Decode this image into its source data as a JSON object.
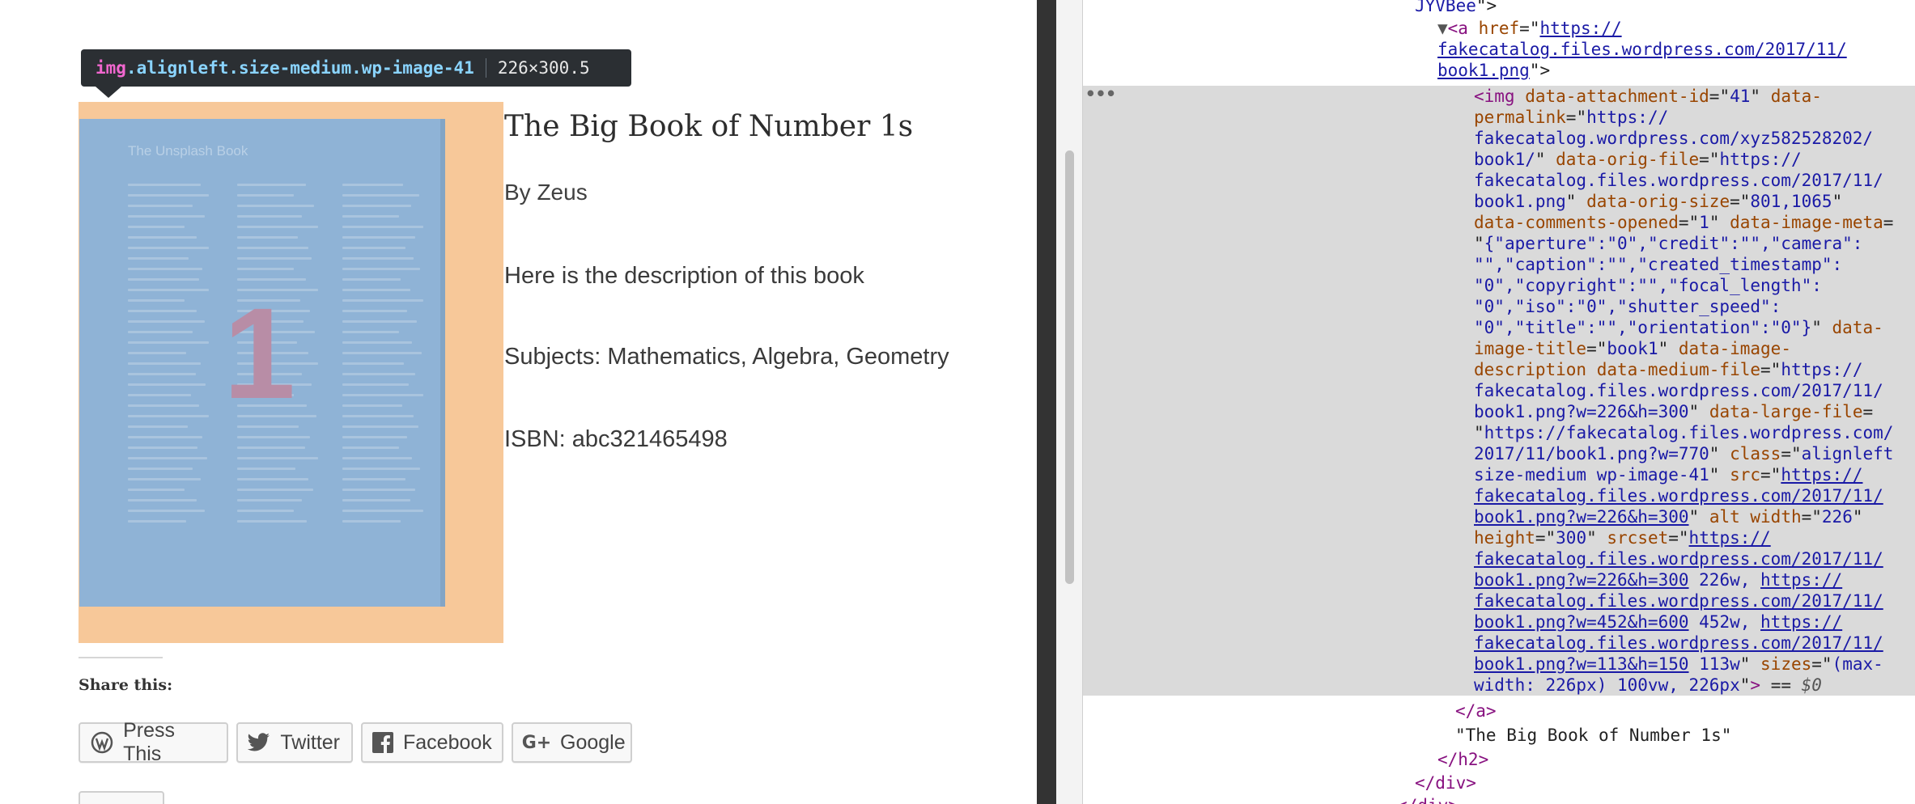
{
  "tooltip": {
    "tag": "img",
    "classes": ".alignleft.size-medium.wp-image-41",
    "dims": "226×300.5"
  },
  "book": {
    "cover_title": "The Unsplash Book",
    "cover_number": "1",
    "title": "The Big Book of Number 1s",
    "author": "By Zeus",
    "description": "Here is the description of this book",
    "subjects": "Subjects: Mathematics, Algebra, Geometry",
    "isbn": "ISBN: abc321465498"
  },
  "share": {
    "label": "Share this:",
    "buttons": [
      {
        "label": "Press This",
        "icon": "wordpress-icon"
      },
      {
        "label": "Twitter",
        "icon": "twitter-icon"
      },
      {
        "label": "Facebook",
        "icon": "facebook-icon"
      },
      {
        "label": "Google",
        "icon": "google-plus-icon"
      }
    ]
  },
  "devtools": {
    "gutter_dots": "•••",
    "lines": [
      [
        {
          "c": "v",
          "t": "JYVBee"
        },
        {
          "c": "p",
          "t": "\">"
        }
      ],
      [
        {
          "c": "tri",
          "t": "▼"
        },
        {
          "c": "t",
          "t": "<a "
        },
        {
          "c": "a",
          "t": "href"
        },
        {
          "c": "p",
          "t": "=\""
        },
        {
          "c": "u",
          "t": "https://"
        }
      ],
      [
        {
          "c": "u",
          "t": "fakecatalog.files.wordpress.com/2017/11/"
        }
      ],
      [
        {
          "c": "u",
          "t": "book1.png"
        },
        {
          "c": "p",
          "t": "\">"
        }
      ],
      [
        {
          "c": "t",
          "t": "<img "
        },
        {
          "c": "a",
          "t": "data-attachment-id"
        },
        {
          "c": "p",
          "t": "=\""
        },
        {
          "c": "v",
          "t": "41"
        },
        {
          "c": "p",
          "t": "\" "
        },
        {
          "c": "a",
          "t": "data-"
        }
      ],
      [
        {
          "c": "a",
          "t": "permalink"
        },
        {
          "c": "p",
          "t": "=\""
        },
        {
          "c": "v",
          "t": "https://"
        }
      ],
      [
        {
          "c": "v",
          "t": "fakecatalog.wordpress.com/xyz582528202/"
        }
      ],
      [
        {
          "c": "v",
          "t": "book1/"
        },
        {
          "c": "p",
          "t": "\" "
        },
        {
          "c": "a",
          "t": "data-orig-file"
        },
        {
          "c": "p",
          "t": "=\""
        },
        {
          "c": "v",
          "t": "https://"
        }
      ],
      [
        {
          "c": "v",
          "t": "fakecatalog.files.wordpress.com/2017/11/"
        }
      ],
      [
        {
          "c": "v",
          "t": "book1.png"
        },
        {
          "c": "p",
          "t": "\" "
        },
        {
          "c": "a",
          "t": "data-orig-size"
        },
        {
          "c": "p",
          "t": "=\""
        },
        {
          "c": "v",
          "t": "801,1065"
        },
        {
          "c": "p",
          "t": "\""
        }
      ],
      [
        {
          "c": "a",
          "t": "data-comments-opened"
        },
        {
          "c": "p",
          "t": "=\""
        },
        {
          "c": "v",
          "t": "1"
        },
        {
          "c": "p",
          "t": "\" "
        },
        {
          "c": "a",
          "t": "data-image-meta"
        },
        {
          "c": "p",
          "t": "="
        }
      ],
      [
        {
          "c": "p",
          "t": "\""
        },
        {
          "c": "v",
          "t": "{\"aperture\":\"0\",\"credit\":\"\",\"camera\":"
        }
      ],
      [
        {
          "c": "v",
          "t": "\"\",\"caption\":\"\",\"created_timestamp\":"
        }
      ],
      [
        {
          "c": "v",
          "t": "\"0\",\"copyright\":\"\",\"focal_length\":"
        }
      ],
      [
        {
          "c": "v",
          "t": "\"0\",\"iso\":\"0\",\"shutter_speed\":"
        }
      ],
      [
        {
          "c": "v",
          "t": "\"0\",\"title\":\"\",\"orientation\":\"0\"}"
        },
        {
          "c": "p",
          "t": "\" "
        },
        {
          "c": "a",
          "t": "data-"
        }
      ],
      [
        {
          "c": "a",
          "t": "image-title"
        },
        {
          "c": "p",
          "t": "=\""
        },
        {
          "c": "v",
          "t": "book1"
        },
        {
          "c": "p",
          "t": "\" "
        },
        {
          "c": "a",
          "t": "data-image-"
        }
      ],
      [
        {
          "c": "a",
          "t": "description data-medium-file"
        },
        {
          "c": "p",
          "t": "=\""
        },
        {
          "c": "v",
          "t": "https://"
        }
      ],
      [
        {
          "c": "v",
          "t": "fakecatalog.files.wordpress.com/2017/11/"
        }
      ],
      [
        {
          "c": "v",
          "t": "book1.png?w=226&h=300"
        },
        {
          "c": "p",
          "t": "\" "
        },
        {
          "c": "a",
          "t": "data-large-file"
        },
        {
          "c": "p",
          "t": "="
        }
      ],
      [
        {
          "c": "p",
          "t": "\""
        },
        {
          "c": "v",
          "t": "https://fakecatalog.files.wordpress.com/"
        }
      ],
      [
        {
          "c": "v",
          "t": "2017/11/book1.png?w=770"
        },
        {
          "c": "p",
          "t": "\" "
        },
        {
          "c": "a",
          "t": "class"
        },
        {
          "c": "p",
          "t": "=\""
        },
        {
          "c": "v",
          "t": "alignleft"
        }
      ],
      [
        {
          "c": "v",
          "t": "size-medium wp-image-41"
        },
        {
          "c": "p",
          "t": "\" "
        },
        {
          "c": "a",
          "t": "src"
        },
        {
          "c": "p",
          "t": "=\""
        },
        {
          "c": "u",
          "t": "https://"
        }
      ],
      [
        {
          "c": "u",
          "t": "fakecatalog.files.wordpress.com/2017/11/"
        }
      ],
      [
        {
          "c": "u",
          "t": "book1.png?w=226&h=300"
        },
        {
          "c": "p",
          "t": "\" "
        },
        {
          "c": "a",
          "t": "alt width"
        },
        {
          "c": "p",
          "t": "=\""
        },
        {
          "c": "v",
          "t": "226"
        },
        {
          "c": "p",
          "t": "\""
        }
      ],
      [
        {
          "c": "a",
          "t": "height"
        },
        {
          "c": "p",
          "t": "=\""
        },
        {
          "c": "v",
          "t": "300"
        },
        {
          "c": "p",
          "t": "\" "
        },
        {
          "c": "a",
          "t": "srcset"
        },
        {
          "c": "p",
          "t": "=\""
        },
        {
          "c": "u",
          "t": "https://"
        }
      ],
      [
        {
          "c": "u",
          "t": "fakecatalog.files.wordpress.com/2017/11/"
        }
      ],
      [
        {
          "c": "u",
          "t": "book1.png?w=226&h=300"
        },
        {
          "c": "v",
          "t": " 226w, "
        },
        {
          "c": "u",
          "t": "https://"
        }
      ],
      [
        {
          "c": "u",
          "t": "fakecatalog.files.wordpress.com/2017/11/"
        }
      ],
      [
        {
          "c": "u",
          "t": "book1.png?w=452&h=600"
        },
        {
          "c": "v",
          "t": " 452w, "
        },
        {
          "c": "u",
          "t": "https://"
        }
      ],
      [
        {
          "c": "u",
          "t": "fakecatalog.files.wordpress.com/2017/11/"
        }
      ],
      [
        {
          "c": "u",
          "t": "book1.png?w=113&h=150"
        },
        {
          "c": "v",
          "t": " 113w"
        },
        {
          "c": "p",
          "t": "\" "
        },
        {
          "c": "a",
          "t": "sizes"
        },
        {
          "c": "p",
          "t": "=\""
        },
        {
          "c": "v",
          "t": "(max-"
        }
      ],
      [
        {
          "c": "v",
          "t": "width: 226px) 100vw, 226px"
        },
        {
          "c": "p",
          "t": "\""
        },
        {
          "c": "t",
          "t": ">"
        },
        {
          "c": "p",
          "t": " == "
        },
        {
          "c": "g",
          "t": "$0"
        }
      ],
      [
        {
          "c": "t",
          "t": "</a>"
        }
      ],
      [
        {
          "c": "p",
          "t": "\"The Big Book of Number 1s\""
        }
      ],
      [
        {
          "c": "t",
          "t": "</h2>"
        }
      ],
      [
        {
          "c": "t",
          "t": "</div>"
        }
      ],
      [
        {
          "c": "t",
          "t": "</div>"
        }
      ]
    ]
  },
  "colors": {
    "highlight": "#f7c899",
    "cover": "#8fb3d6",
    "selected_row": "#dadada",
    "tag": "#881280",
    "attr": "#994500",
    "value": "#1a1aa6"
  }
}
